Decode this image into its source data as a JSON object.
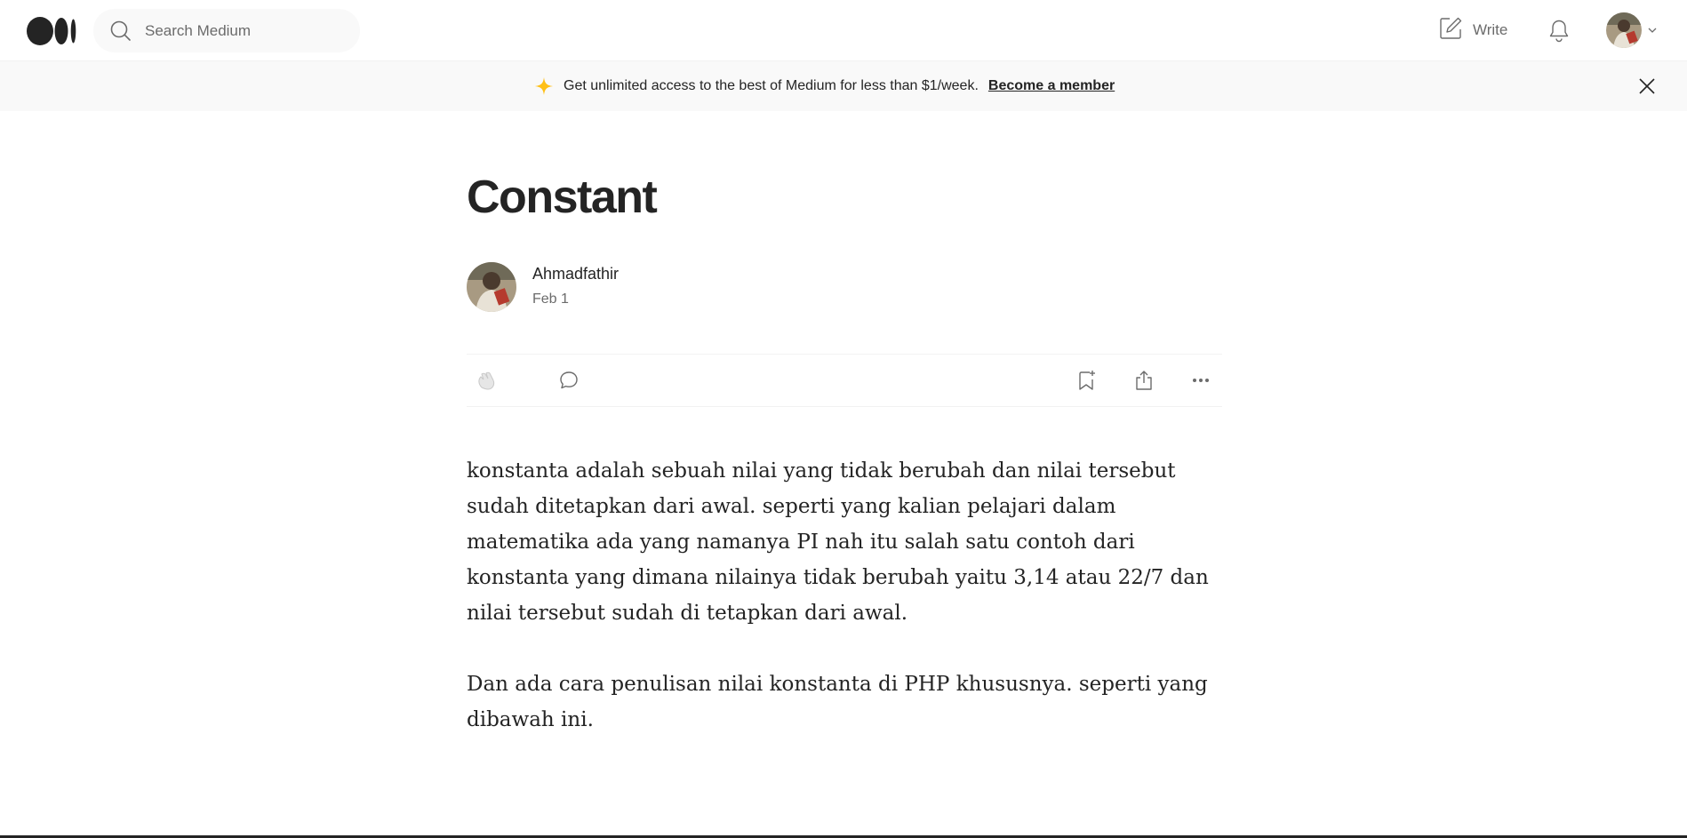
{
  "nav": {
    "search_placeholder": "Search Medium",
    "write_label": "Write"
  },
  "banner": {
    "text": "Get unlimited access to the best of Medium for less than $1/week.",
    "link": "Become a member",
    "accent_color": "#ffc017"
  },
  "article": {
    "title": "Constant",
    "author": "Ahmadfathir",
    "date": "Feb 1",
    "paragraphs": [
      "konstanta adalah sebuah nilai yang tidak berubah dan nilai tersebut sudah ditetapkan dari awal. seperti yang kalian pelajari dalam matematika ada yang namanya PI nah itu salah satu contoh dari konstanta yang dimana nilainya tidak berubah yaitu 3,14 atau 22/7 dan nilai tersebut sudah di tetapkan dari awal.",
      "Dan ada cara penulisan nilai konstanta di PHP khususnya. seperti yang dibawah ini."
    ]
  },
  "icons": {
    "logo": "medium-logo-icon",
    "search": "search-icon",
    "write": "write-icon",
    "notifications": "bell-icon",
    "sparkle": "sparkle-icon",
    "close": "close-icon",
    "clap": "clap-icon",
    "comment": "comment-icon",
    "bookmark": "bookmark-icon",
    "share": "share-icon",
    "more": "more-icon"
  }
}
